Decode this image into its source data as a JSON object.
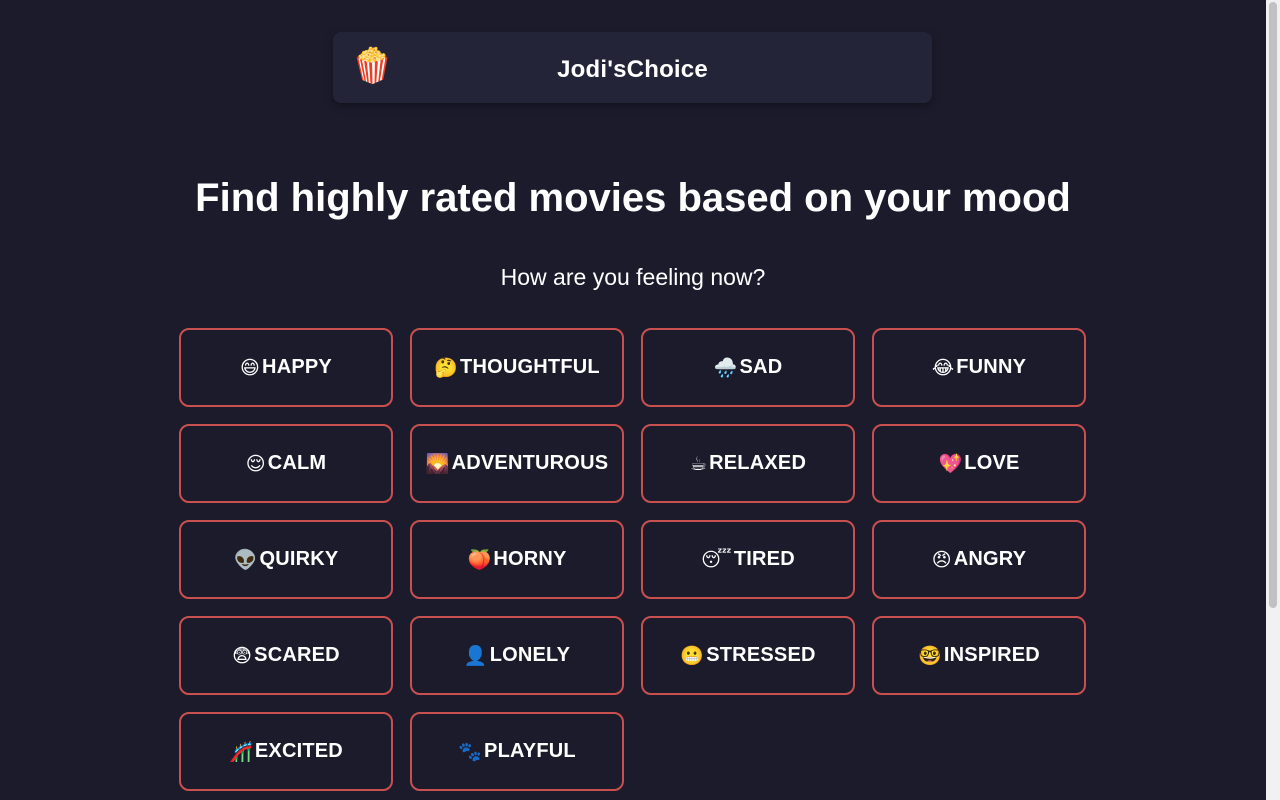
{
  "header": {
    "logo": "🍿",
    "title": "Jodi'sChoice"
  },
  "headline": "Find highly rated movies based on your mood",
  "subhead": "How are you feeling now?",
  "moods": [
    {
      "key": "happy",
      "emoji": "😄",
      "label": "HAPPY"
    },
    {
      "key": "thoughtful",
      "emoji": "🤔",
      "label": "THOUGHTFUL"
    },
    {
      "key": "sad",
      "emoji": "🌧️",
      "label": "SAD"
    },
    {
      "key": "funny",
      "emoji": "😂",
      "label": "FUNNY"
    },
    {
      "key": "calm",
      "emoji": "😌",
      "label": "CALM"
    },
    {
      "key": "adventurous",
      "emoji": "🌄",
      "label": "ADVENTUROUS"
    },
    {
      "key": "relaxed",
      "emoji": "☕",
      "label": "RELAXED"
    },
    {
      "key": "love",
      "emoji": "💖",
      "label": "LOVE"
    },
    {
      "key": "quirky",
      "emoji": "👽",
      "label": "QUIRKY"
    },
    {
      "key": "horny",
      "emoji": "🍑",
      "label": "HORNY"
    },
    {
      "key": "tired",
      "emoji": "😴",
      "label": "TIRED"
    },
    {
      "key": "angry",
      "emoji": "😠",
      "label": "ANGRY"
    },
    {
      "key": "scared",
      "emoji": "😨",
      "label": "SCARED"
    },
    {
      "key": "lonely",
      "emoji": "👤",
      "label": "LONELY"
    },
    {
      "key": "stressed",
      "emoji": "😬",
      "label": "STRESSED"
    },
    {
      "key": "inspired",
      "emoji": "🤓",
      "label": "INSPIRED"
    },
    {
      "key": "excited",
      "emoji": "🎢",
      "label": "EXCITED"
    },
    {
      "key": "playful",
      "emoji": "🐾",
      "label": "PLAYFUL"
    }
  ],
  "colors": {
    "background": "#1c1b2c",
    "header_bg": "#232437",
    "button_border": "#c9504f",
    "text": "#ffffff"
  }
}
